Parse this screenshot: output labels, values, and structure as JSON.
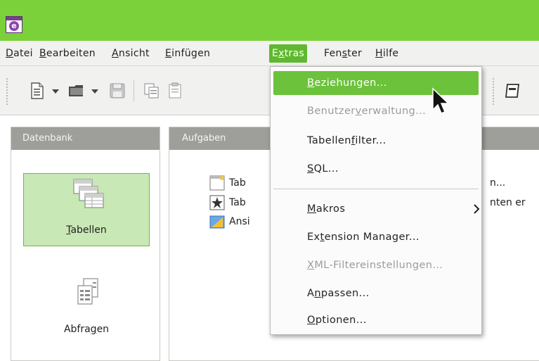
{
  "menubar": {
    "items": [
      {
        "pre": "",
        "mn": "D",
        "post": "atei"
      },
      {
        "pre": "",
        "mn": "B",
        "post": "earbeiten"
      },
      {
        "pre": "",
        "mn": "A",
        "post": "nsicht"
      },
      {
        "pre": "",
        "mn": "E",
        "post": "infügen"
      },
      {
        "pre": "E",
        "mn": "x",
        "post": "tras"
      },
      {
        "pre": "Fen",
        "mn": "s",
        "post": "ter"
      },
      {
        "pre": "",
        "mn": "H",
        "post": "ilfe"
      }
    ]
  },
  "panels": {
    "left_title": "Datenbank",
    "right_title": "Aufgaben"
  },
  "database_items": [
    {
      "pre": "",
      "mn": "T",
      "post": "abellen"
    },
    {
      "pre": "Abfra",
      "mn": "g",
      "post": "en"
    }
  ],
  "tasks": [
    {
      "text": "Tab",
      "right": "n..."
    },
    {
      "text": "Tab",
      "right": "nten er"
    },
    {
      "text": "Ansi",
      "right": ""
    }
  ],
  "extras_menu": [
    {
      "pre": "",
      "mn": "B",
      "post": "eziehungen...",
      "state": "highlighted"
    },
    {
      "pre": "Benutzer",
      "mn": "v",
      "post": "erwaltung...",
      "state": "disabled"
    },
    {
      "pre": "Tabellen",
      "mn": "f",
      "post": "ilter...",
      "state": "normal"
    },
    {
      "pre": "",
      "mn": "S",
      "post": "QL...",
      "state": "normal"
    },
    {
      "pre": "",
      "mn": "M",
      "post": "akros",
      "state": "normal",
      "submenu": true
    },
    {
      "pre": "Ex",
      "mn": "t",
      "post": "ension Manager...",
      "state": "normal"
    },
    {
      "pre": "",
      "mn": "X",
      "post": "ML-Filtereinstellungen...",
      "state": "disabled"
    },
    {
      "pre": "A",
      "mn": "n",
      "post": "passen...",
      "state": "normal"
    },
    {
      "pre": "",
      "mn": "O",
      "post": "ptionen...",
      "state": "normal"
    }
  ],
  "colors": {
    "titlebar": "#7ad13a",
    "highlight": "#6cc23a",
    "selected_item_bg": "#c8e8b5",
    "panel_header": "#9e9e9a"
  }
}
